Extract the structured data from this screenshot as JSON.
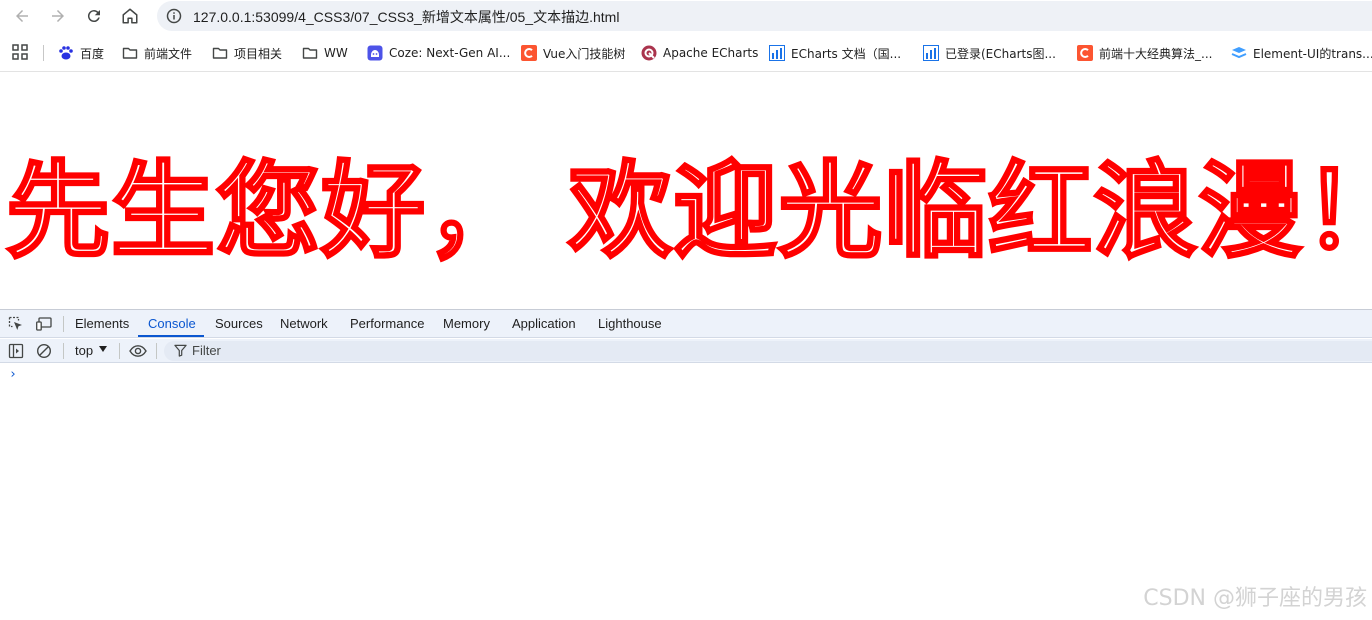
{
  "browser": {
    "url": "127.0.0.1:53099/4_CSS3/07_CSS3_新增文本属性/05_文本描边.html",
    "nav_icons": [
      "back-arrow-icon",
      "forward-arrow-icon",
      "reload-icon",
      "home-icon",
      "site-info-icon"
    ]
  },
  "bookmarks": [
    {
      "label": "百度",
      "icon": "baidu-paw-icon",
      "color": "#2932e1"
    },
    {
      "label": "前端文件",
      "icon": "folder-icon",
      "color": "#444746"
    },
    {
      "label": "项目相关",
      "icon": "folder-icon",
      "color": "#444746"
    },
    {
      "label": "WW",
      "icon": "folder-icon",
      "color": "#444746"
    },
    {
      "label": "Coze: Next-Gen AI...",
      "icon": "coze-icon",
      "color": "#4d53e8"
    },
    {
      "label": "Vue入门技能树",
      "icon": "csdn-c-icon",
      "color": "#fc5531"
    },
    {
      "label": "Apache ECharts",
      "icon": "echarts-icon",
      "color": "#aa344d"
    },
    {
      "label": "ECharts 文档（国...",
      "icon": "chart-bar-icon",
      "color": "#1a73e8"
    },
    {
      "label": "已登录(ECharts图...",
      "icon": "chart-bar-icon",
      "color": "#1a73e8"
    },
    {
      "label": "前端十大经典算法_...",
      "icon": "csdn-c-icon",
      "color": "#fc5531"
    },
    {
      "label": "Element-UI的trans...",
      "icon": "element-icon",
      "color": "#409eff"
    }
  ],
  "page": {
    "headline": "先生您好， 欢迎光临红浪漫！",
    "stroke_color": "#ff0000",
    "fill_color": "#ffffff"
  },
  "devtools": {
    "tabs": [
      "Elements",
      "Console",
      "Sources",
      "Network",
      "Performance",
      "Memory",
      "Application",
      "Lighthouse"
    ],
    "active_tab": "Console",
    "context": "top",
    "filter_placeholder": "Filter",
    "prompt_symbol": "›"
  },
  "watermark": "CSDN @狮子座的男孩"
}
